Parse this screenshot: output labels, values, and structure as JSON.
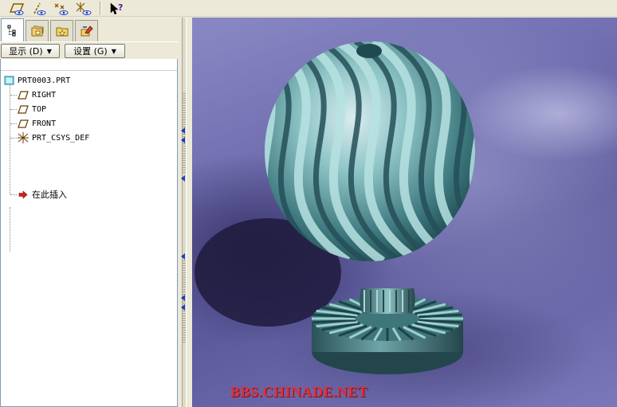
{
  "toolbar": {
    "buttons": [
      {
        "icon": "datum-plane-display-icon"
      },
      {
        "icon": "datum-axis-display-icon"
      },
      {
        "icon": "datum-point-display-icon"
      },
      {
        "icon": "coordinate-system-display-icon"
      },
      {
        "icon": "context-help-icon"
      }
    ]
  },
  "left_panel": {
    "tabs": [
      {
        "icon": "model-tree-icon",
        "active": true
      },
      {
        "icon": "folder-browser-icon",
        "active": false
      },
      {
        "icon": "favorites-icon",
        "active": false
      },
      {
        "icon": "connections-icon",
        "active": false
      }
    ],
    "show_menu": "显示 (D)",
    "settings_menu": "设置 (G)"
  },
  "model_tree": {
    "root": "PRT0003.PRT",
    "items": [
      {
        "label": "RIGHT",
        "icon": "datum-plane-icon"
      },
      {
        "label": "TOP",
        "icon": "datum-plane-icon"
      },
      {
        "label": "FRONT",
        "icon": "datum-plane-icon"
      },
      {
        "label": "PRT_CSYS_DEF",
        "icon": "coordinate-system-icon"
      }
    ],
    "insert_here": "在此插入"
  },
  "graphics": {
    "model": "spiral-ribbed-sphere-on-fluted-pedestal",
    "watermark": "BBS.CHINADE.NET"
  },
  "colors": {
    "model_teal": "#5f9a9c",
    "background_purple": "#6e6cae",
    "watermark_red": "#e0303a"
  }
}
